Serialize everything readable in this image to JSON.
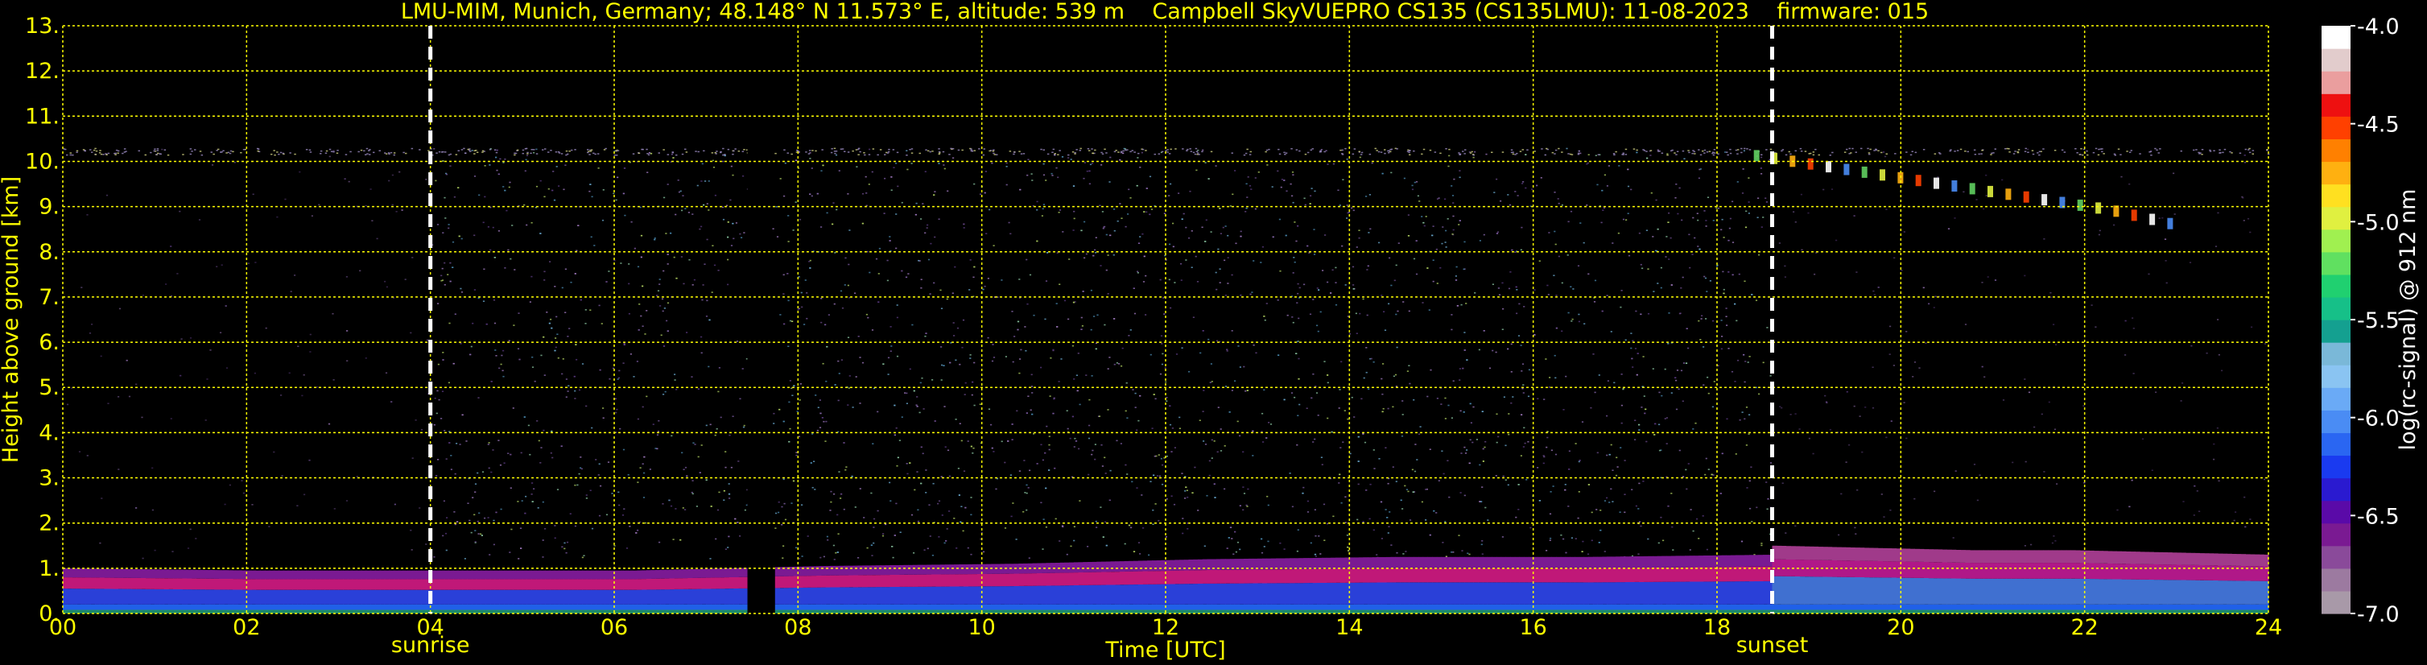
{
  "chart_data": {
    "type": "heatmap",
    "title": "LMU-MIM, Munich, Germany; 48.148° N 11.573° E, altitude: 539 m    Campbell SkyVUEPRO CS135 (CS135LMU): 11-08-2023    firmware: 015",
    "xlabel": "Time [UTC]",
    "ylabel": "Height above ground [km]",
    "xlim": [
      0,
      24
    ],
    "ylim": [
      0,
      13
    ],
    "x_ticks": [
      "00",
      "02",
      "04",
      "06",
      "08",
      "10",
      "12",
      "14",
      "16",
      "18",
      "20",
      "22",
      "24"
    ],
    "y_ticks": [
      "0.",
      "1.",
      "2.",
      "3.",
      "4.",
      "5.",
      "6.",
      "7.",
      "8.",
      "9.",
      "10.",
      "11.",
      "12.",
      "13."
    ],
    "grid": true,
    "grid_color": "#ffff00",
    "markers": [
      {
        "label": "sunrise",
        "x": 4.0
      },
      {
        "label": "sunset",
        "x": 18.6
      }
    ],
    "data_gap": [
      7.45,
      7.7
    ],
    "signal_top_km": 10.3,
    "colorbar": {
      "label": "log(rc-signal) @ 912 nm",
      "range": [
        -7.0,
        -4.0
      ],
      "ticks": [
        "-4.0",
        "-4.5",
        "-5.0",
        "-5.5",
        "-6.0",
        "-6.5",
        "-7.0"
      ],
      "colors": [
        "#a899a8",
        "#9c7aa0",
        "#8a4a9a",
        "#7a1a92",
        "#5a0aa8",
        "#2a1ad0",
        "#1a3af0",
        "#2a66f2",
        "#4a8cf4",
        "#6aaaf6",
        "#8ac4f2",
        "#7ab8d8",
        "#14a090",
        "#16c088",
        "#20d070",
        "#60e060",
        "#a0f050",
        "#e0f040",
        "#ffe020",
        "#ffb010",
        "#ff8000",
        "#ff4000",
        "#ee1010",
        "#ea9e9e",
        "#e2cccc",
        "#ffffff"
      ]
    },
    "layers": [
      {
        "name": "boundary-layer",
        "x0": 0,
        "x1": 18.6,
        "top_km": [
          1.0,
          0.95,
          0.95,
          0.95,
          1.05,
          1.1,
          1.2,
          1.25,
          1.25,
          1.3
        ],
        "color": "#7a1a92"
      },
      {
        "name": "residual-layer",
        "x0": 18.6,
        "x1": 24,
        "top_km": [
          1.5,
          1.45,
          1.4,
          1.4,
          1.35,
          1.3
        ],
        "color": "#a03a8a"
      },
      {
        "name": "cirrus",
        "x0": 18.4,
        "x1": 22.9,
        "height_km": [
          10.0,
          9.8,
          9.6,
          9.4,
          9.2,
          9.0,
          8.8,
          8.5
        ]
      }
    ]
  }
}
